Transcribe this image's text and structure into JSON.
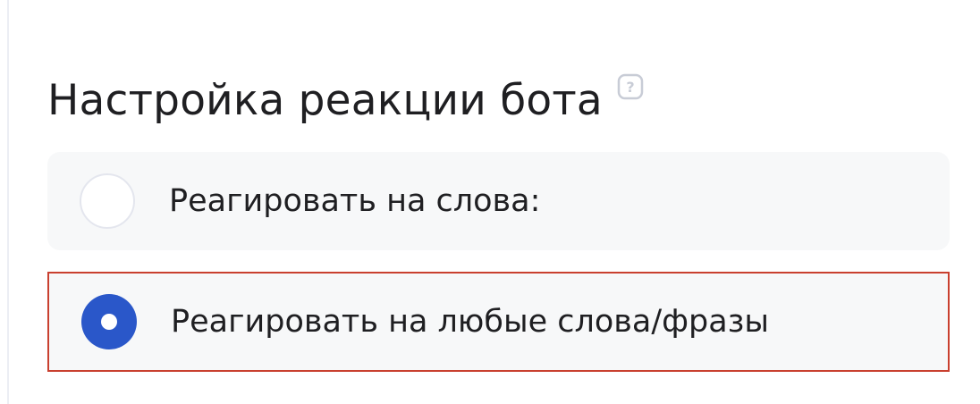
{
  "section": {
    "title": "Настройка реакции бота",
    "help_icon": "question-mark-icon"
  },
  "options": [
    {
      "label": "Реагировать на слова:",
      "selected": false
    },
    {
      "label": "Реагировать на любые слова/фразы",
      "selected": true
    }
  ],
  "colors": {
    "accent": "#2a57c9",
    "highlight_border": "#c9402f",
    "option_background": "#f7f8f9",
    "text": "#1f1f22"
  }
}
